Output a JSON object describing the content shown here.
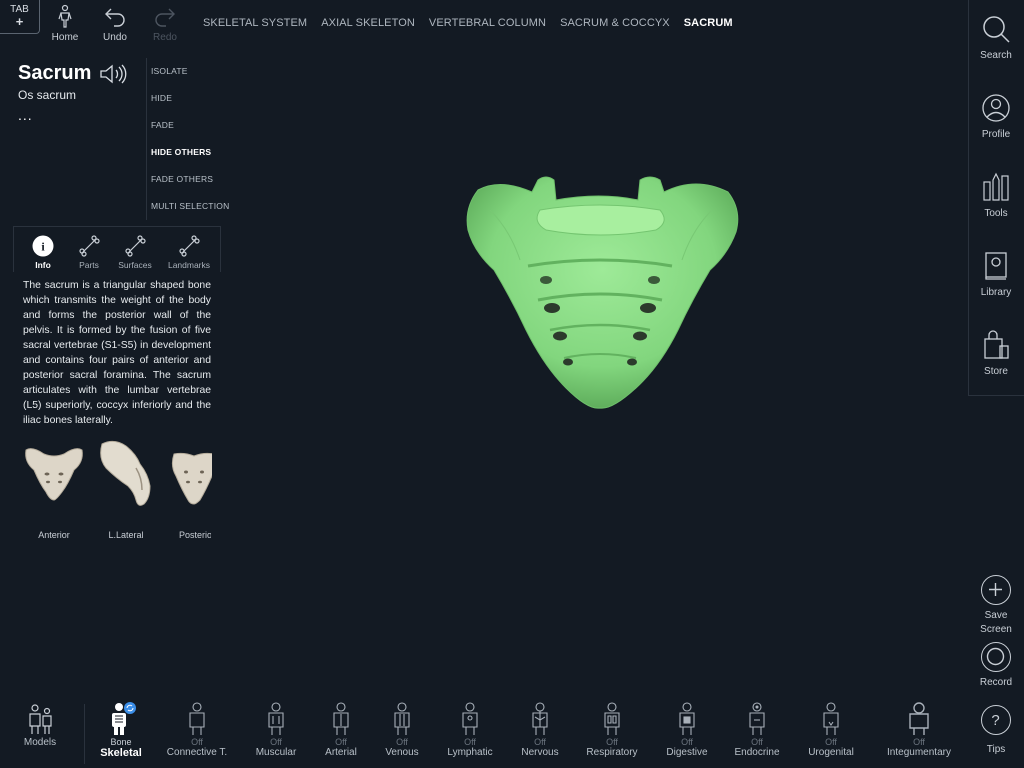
{
  "top_left": {
    "tab_label": "TAB",
    "tab_plus": "+"
  },
  "toolbar": {
    "home": "Home",
    "undo": "Undo",
    "redo": "Redo"
  },
  "breadcrumb": [
    "SKELETAL SYSTEM",
    "AXIAL SKELETON",
    "VERTEBRAL COLUMN",
    "SACRUM & COCCYX",
    "SACRUM"
  ],
  "structure": {
    "title": "Sacrum",
    "latin": "Os sacrum",
    "more": "..."
  },
  "actions": [
    "ISOLATE",
    "HIDE",
    "FADE",
    "HIDE OTHERS",
    "FADE OTHERS",
    "MULTI SELECTION"
  ],
  "info_tabs": [
    "Info",
    "Parts",
    "Surfaces",
    "Landmarks"
  ],
  "description": "The sacrum is a triangular shaped bone which transmits the weight of the body and forms the posterior wall of the pelvis. It is formed by the fusion of five sacral vertebrae (S1-S5) in development and contains four pairs of anterior and posterior sacral foramina. The sacrum articulates with the lumbar vertebrae (L5) superiorly, coccyx inferiorly and the iliac bones laterally.",
  "thumbnails": [
    "Anterior",
    "L.Lateral",
    "Posterior"
  ],
  "right_bar": [
    "Search",
    "Profile",
    "Tools",
    "Library",
    "Store"
  ],
  "right_bottom": {
    "save": "Save Screen",
    "record": "Record",
    "tips": "Tips"
  },
  "bottom": {
    "models": "Models",
    "systems": [
      {
        "state": "Bone",
        "name": "Skeletal"
      },
      {
        "state": "Off",
        "name": "Connective T."
      },
      {
        "state": "Off",
        "name": "Muscular"
      },
      {
        "state": "Off",
        "name": "Arterial"
      },
      {
        "state": "Off",
        "name": "Venous"
      },
      {
        "state": "Off",
        "name": "Lymphatic"
      },
      {
        "state": "Off",
        "name": "Nervous"
      },
      {
        "state": "Off",
        "name": "Respiratory"
      },
      {
        "state": "Off",
        "name": "Digestive"
      },
      {
        "state": "Off",
        "name": "Endocrine"
      },
      {
        "state": "Off",
        "name": "Urogenital"
      },
      {
        "state": "Off",
        "name": "Integumentary"
      }
    ]
  },
  "colors": {
    "background": "#131a23",
    "bone": "#8be08a",
    "accent": "#3b8ee8"
  }
}
